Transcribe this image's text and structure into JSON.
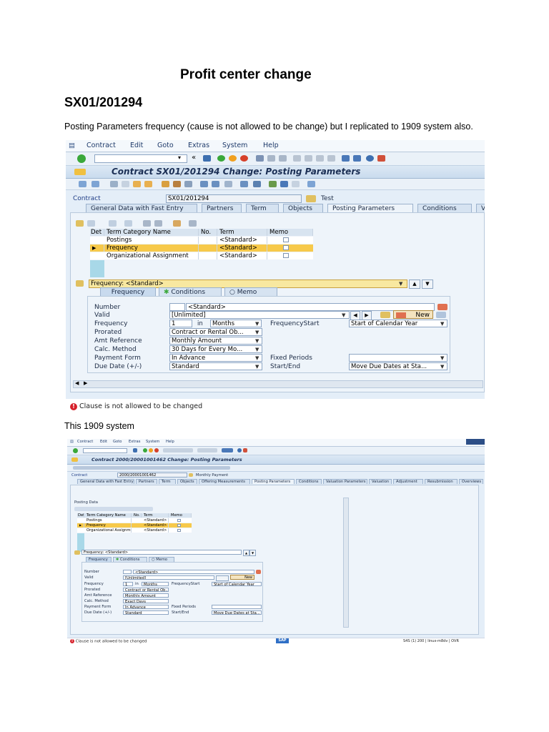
{
  "doc": {
    "heading": "Profit center change",
    "subheading": "SX01/201294",
    "paragraph": "Posting Parameters frequency (cause is not allowed to be change) but I replicated to 1909 system also.",
    "caption2": "This 1909 system"
  },
  "shot1": {
    "menu": [
      "Contract",
      "Edit",
      "Goto",
      "Extras",
      "System",
      "Help"
    ],
    "title": "Contract SX01/201294 Change: Posting Parameters",
    "contract_label": "Contract",
    "contract_value": "SX01/201294",
    "contract_desc": "Test",
    "tabs": [
      "General Data with Fast Entry",
      "Partners",
      "Term",
      "Objects",
      "Posting Parameters",
      "Conditions",
      "V"
    ],
    "grid_headers": [
      "Det",
      "Term Category Name",
      "No.",
      "Term",
      "Memo"
    ],
    "grid_rows": [
      {
        "name": "Postings",
        "term": "<Standard>"
      },
      {
        "name": "Frequency",
        "term": "<Standard>"
      },
      {
        "name": "Organizational Assignment",
        "term": "<Standard>"
      }
    ],
    "detail_header": "Frequency: <Standard>",
    "subtabs": [
      "Frequency",
      "Conditions",
      "Memo"
    ],
    "fields": {
      "number_label": "Number",
      "number_value": "<Standard>",
      "valid_label": "Valid",
      "valid_value": "[Unlimited]",
      "new_button": "New",
      "frequency_label": "Frequency",
      "frequency_num": "1",
      "frequency_in": "in",
      "frequency_unit": "Months",
      "frequency_start_label": "FrequencyStart",
      "frequency_start_value": "Start of Calendar Year",
      "prorated_label": "Prorated",
      "prorated_value": "Contract or Rental Ob...",
      "amt_label": "Amt Reference",
      "amt_value": "Monthly Amount",
      "calc_label": "Calc. Method",
      "calc_value": "30 Days for Every Mo...",
      "payment_label": "Payment Form",
      "payment_value": "In Advance",
      "fixed_label": "Fixed Periods",
      "fixed_value": "",
      "due_label": "Due Date (+/-)",
      "due_value": "Standard",
      "startend_label": "Start/End",
      "startend_value": "Move Due Dates at Sta..."
    },
    "status_message": "Clause  is not allowed to be changed"
  },
  "shot2": {
    "menu": [
      "Contract",
      "Edit",
      "Goto",
      "Extras",
      "System",
      "Help"
    ],
    "title": "Contract 2000/20001001462 Change: Posting Parameters",
    "contract_label": "Contract",
    "contract_value": "2000/20001001462",
    "contract_desc": "Monthly Payment",
    "tabs": [
      "General Data with Fast Entry",
      "Partners",
      "Term",
      "Objects",
      "Offering Measurements",
      "Posting Parameters",
      "Conditions",
      "Valuation Parameters",
      "Valuation",
      "Adjustment",
      "Resubmission",
      "Overviews"
    ],
    "section_title": "Posting Data",
    "grid_headers": [
      "Det",
      "Term Category Name",
      "No.",
      "Term",
      "Memo"
    ],
    "grid_rows": [
      {
        "name": "Postings",
        "term": "<Standard>"
      },
      {
        "name": "Frequency",
        "term": "<Standard>"
      },
      {
        "name": "Organizational Assignment",
        "term": "<Standard>"
      }
    ],
    "detail_header": "Frequency: <Standard>",
    "subtabs": [
      "Frequency",
      "Conditions",
      "Memo"
    ],
    "fields": {
      "number_label": "Number",
      "number_value": "<Standard>",
      "valid_label": "Valid",
      "valid_value": "[Unlimited]",
      "new_button": "New",
      "frequency_label": "Frequency",
      "frequency_num": "1",
      "frequency_in": "in",
      "frequency_unit": "Months",
      "frequency_start_label": "FrequencyStart",
      "frequency_start_value": "Start of Calendar Year",
      "prorated_label": "Prorated",
      "prorated_value": "Contract or Rental Ob...",
      "amt_label": "Amt Reference",
      "amt_value": "Monthly Amount",
      "calc_label": "Calc. Method",
      "calc_value": "Exact Days",
      "payment_label": "Payment Form",
      "payment_value": "In Advance",
      "fixed_label": "Fixed Periods",
      "fixed_value": "",
      "due_label": "Due Date (+/-)",
      "due_value": "Standard",
      "startend_label": "Start/End",
      "startend_value": "Move Due Dates at Sta..."
    },
    "status_message": "Clause  is not allowed to be changed",
    "status_right": "S4S (1) 200",
    "status_host": "linux-m8dv",
    "status_mode": "OVR",
    "sap_logo": "SAP"
  },
  "colors": {
    "sap_bg": "#e4eef8",
    "selected_row": "#f7c94a",
    "error_red": "#d6202a",
    "title_text": "#1b2f55"
  }
}
